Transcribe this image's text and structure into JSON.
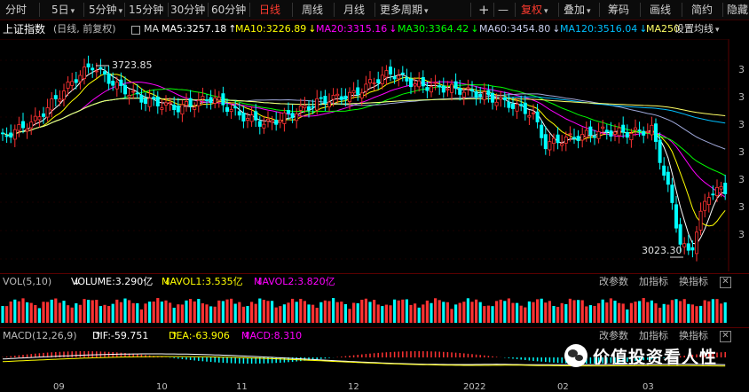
{
  "toolbar": {
    "periods": [
      "分时",
      "5日",
      "5分钟",
      "15分钟",
      "30分钟",
      "60分钟",
      "日线",
      "周线",
      "月线",
      "更多周期"
    ],
    "selected": "日线",
    "plus": "+",
    "minus": "—",
    "fuquan": "复权",
    "overlay": "叠加",
    "chips": "筹码",
    "draw": "画线",
    "simple": "简约",
    "hide": "隐藏"
  },
  "info": {
    "index_name": "上证指数",
    "mode": "(日线, 前复权)",
    "ma_label": "MA",
    "ma5": "MA5:3257.18",
    "ma10": "MA10:3226.89",
    "ma20": "MA20:3315.16",
    "ma30": "MA30:3364.42",
    "ma60": "MA60:3454.80",
    "ma120": "MA120:3516.04",
    "ma250": "MA250",
    "settings": "设置均线"
  },
  "arrows": {
    "up": "↑",
    "down": "↓"
  },
  "annotations": {
    "high": "3723.85",
    "low": "3023.30"
  },
  "volume": {
    "label": "VOL(5,10)",
    "volume": "VOLUME:3.290亿",
    "mavol1": "MAVOL1:3.535亿",
    "mavol2": "MAVOL2:3.820亿"
  },
  "macd": {
    "label": "MACD(12,26,9)",
    "dif": "DIF:-59.751",
    "dea": "DEA:-63.906",
    "macd": "MACD:8.310"
  },
  "buttons": {
    "params": "改参数",
    "add": "加指标",
    "switch": "换指标",
    "close": "✕"
  },
  "x_labels": [
    "09",
    "10",
    "11",
    "12",
    "2022",
    "02",
    "03"
  ],
  "right_axis_digit": "3",
  "watermark": "价值投资看人性",
  "colors": {
    "up": "#ff3232",
    "down": "#00ffff",
    "ma5": "#ffffff",
    "ma10": "#ffff00",
    "ma20": "#ff00ff",
    "ma30": "#00ff00",
    "ma60": "#9fa8da",
    "ma120": "#00bfff",
    "ma250": "#ffff66"
  }
}
